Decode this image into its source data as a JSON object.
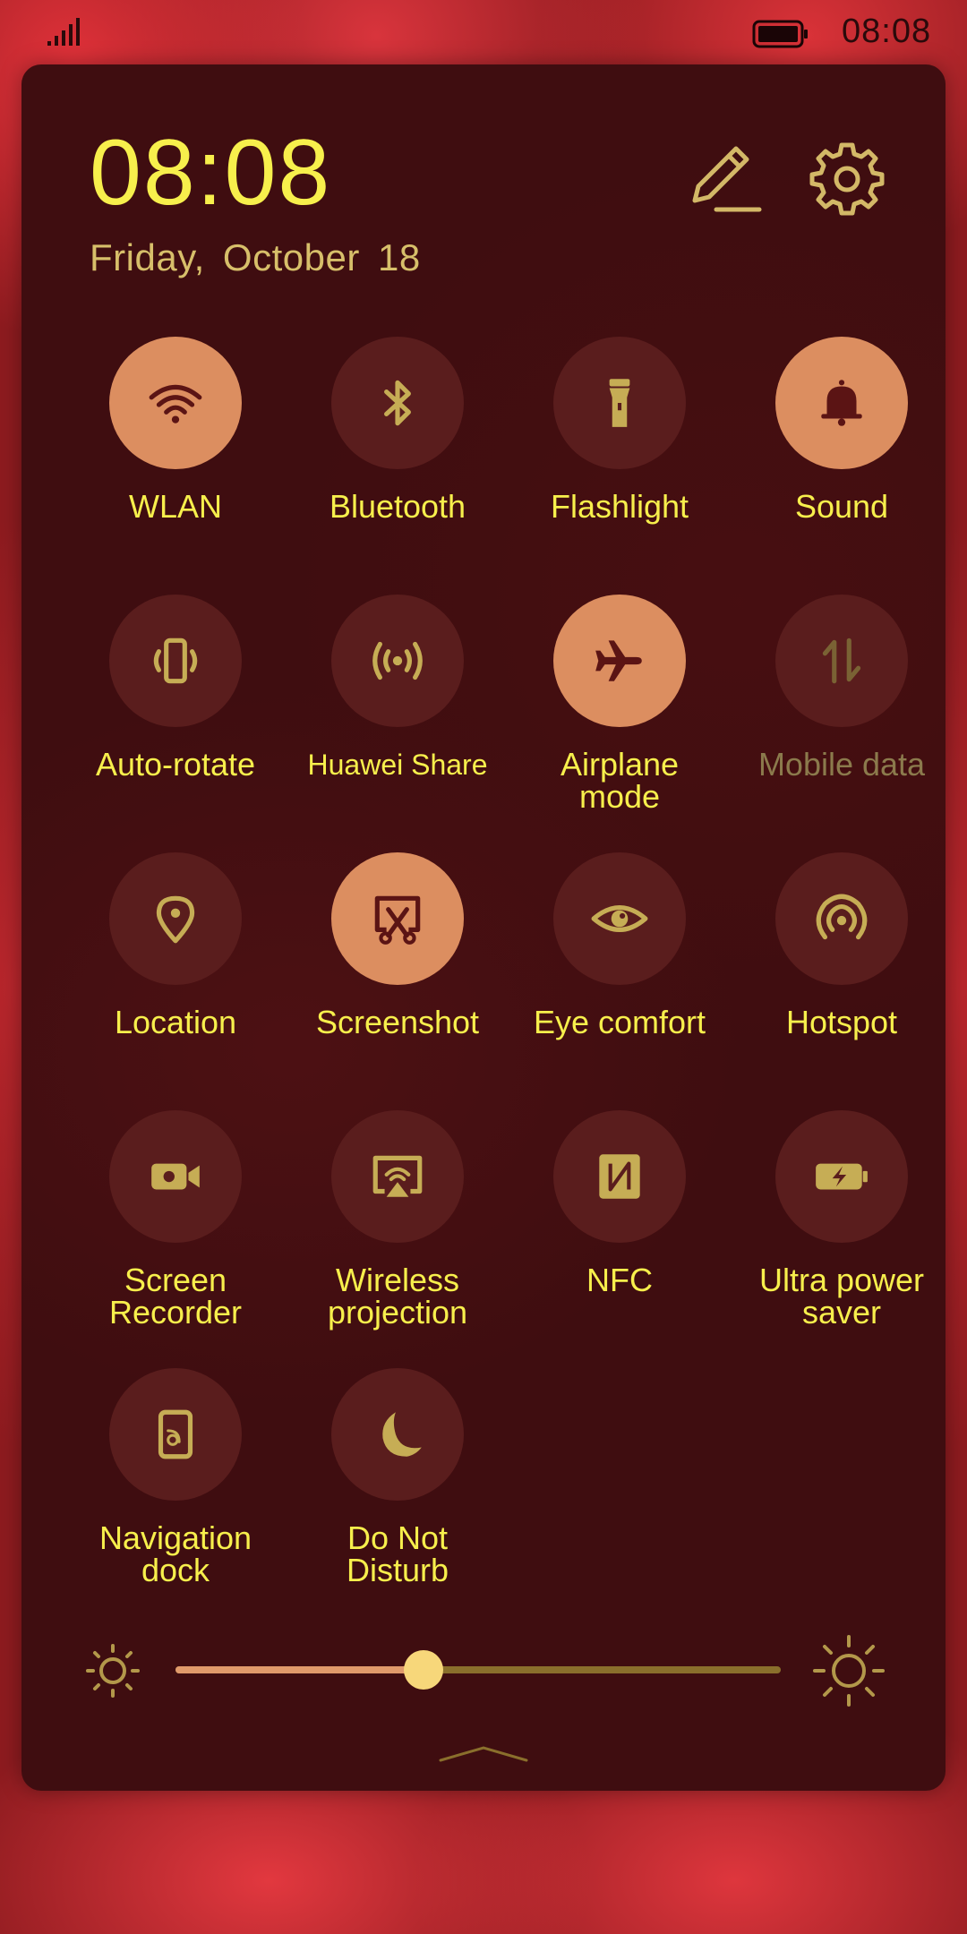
{
  "status_bar": {
    "time": "08:08",
    "signal_icon": "signal-icon",
    "battery_icon": "battery-icon"
  },
  "header": {
    "time": "08:08",
    "date": "Friday, October 18",
    "edit_icon": "pencil-icon",
    "settings_icon": "gear-icon"
  },
  "tiles": [
    {
      "label": "WLAN",
      "icon": "wifi-icon",
      "state": "on"
    },
    {
      "label": "Bluetooth",
      "icon": "bluetooth-icon",
      "state": "off"
    },
    {
      "label": "Flashlight",
      "icon": "flashlight-icon",
      "state": "off"
    },
    {
      "label": "Sound",
      "icon": "bell-icon",
      "state": "on"
    },
    {
      "label": "Auto-rotate",
      "icon": "auto-rotate-icon",
      "state": "off"
    },
    {
      "label": "Huawei Share",
      "icon": "share-icon",
      "state": "off"
    },
    {
      "label": "Airplane\nmode",
      "icon": "airplane-icon",
      "state": "on"
    },
    {
      "label": "Mobile data",
      "icon": "mobile-data-icon",
      "state": "disabled"
    },
    {
      "label": "Location",
      "icon": "location-icon",
      "state": "off"
    },
    {
      "label": "Screenshot",
      "icon": "screenshot-icon",
      "state": "on"
    },
    {
      "label": "Eye comfort",
      "icon": "eye-icon",
      "state": "off"
    },
    {
      "label": "Hotspot",
      "icon": "hotspot-icon",
      "state": "off"
    },
    {
      "label": "Screen\nRecorder",
      "icon": "screen-recorder-icon",
      "state": "off"
    },
    {
      "label": "Wireless\nprojection",
      "icon": "wireless-projection-icon",
      "state": "off"
    },
    {
      "label": "NFC",
      "icon": "nfc-icon",
      "state": "off"
    },
    {
      "label": "Ultra power\nsaver",
      "icon": "power-saver-icon",
      "state": "off"
    },
    {
      "label": "Navigation\ndock",
      "icon": "navigation-dock-icon",
      "state": "off"
    },
    {
      "label": "Do Not\nDisturb",
      "icon": "moon-icon",
      "state": "off"
    }
  ],
  "brightness": {
    "level": 0.41,
    "low_icon": "brightness-low-icon",
    "high_icon": "brightness-high-icon"
  },
  "colors": {
    "accent_text": "#f7ef4c",
    "tile_on": "#dc8e60",
    "tile_off": "#5a1d1d",
    "panel": "#3f0d10",
    "wallpaper": "#d8343c"
  }
}
